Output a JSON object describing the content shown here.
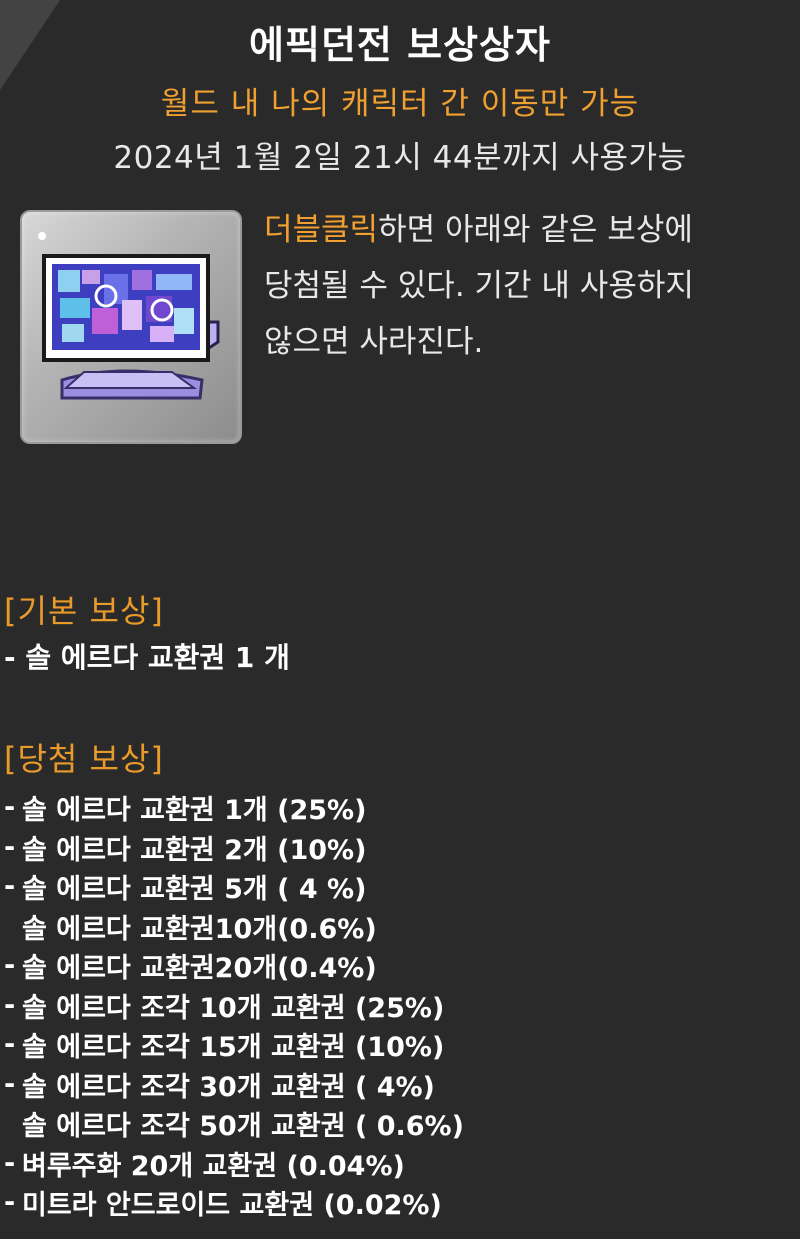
{
  "tooltip": {
    "title": "에픽던전 보상상자",
    "restriction": "월드 내 나의 캐릭터 간 이동만 가능",
    "expiry": "2024년 1월 2일 21시 44분까지 사용가능",
    "description": {
      "highlight": "더블클릭",
      "line1_rest": "하면 아래와 같은 보상에",
      "line2": "당첨될 수 있다. 기간 내 사용하지",
      "line3": "않으면 사라진다."
    },
    "icon": "monitor-coupon-icon"
  },
  "basic_reward": {
    "header": "[기본 보상]",
    "item": "- 솔 에르다 교환권 1 개"
  },
  "lucky_reward": {
    "header": "[당첨 보상]",
    "items": [
      "솔 에르다 교환권 1개 (25%)",
      "솔 에르다 교환권 2개 (10%)",
      "솔 에르다 교환권 5개 ( 4 %)",
      "솔 에르다 교환권10개(0.6%)",
      "솔 에르다 교환권20개(0.4%)",
      "솔 에르다 조각 10개 교환권 (25%)",
      "솔 에르다 조각 15개 교환권 (10%)",
      "솔 에르다 조각 30개 교환권 ( 4%)",
      "솔 에르다 조각 50개 교환권 ( 0.6%)",
      "벼루주화 20개 교환권 (0.04%)",
      "미트라 안드로이드 교환권 (0.02%)"
    ]
  },
  "colors": {
    "background": "#2a2a2a",
    "accent": "#f0a030",
    "text": "#ffffff"
  }
}
